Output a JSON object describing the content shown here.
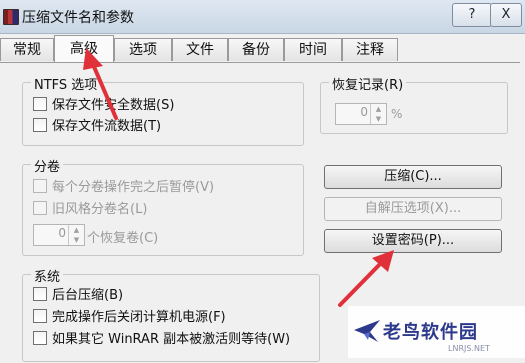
{
  "window": {
    "title": "压缩文件名和参数",
    "help_label": "?",
    "close_label": "X"
  },
  "tabs": [
    {
      "label": "常规"
    },
    {
      "label": "高级",
      "active": true
    },
    {
      "label": "选项"
    },
    {
      "label": "文件"
    },
    {
      "label": "备份"
    },
    {
      "label": "时间"
    },
    {
      "label": "注释"
    }
  ],
  "ntfs": {
    "title": "NTFS 选项",
    "items": [
      {
        "label": "保存文件安全数据(S)",
        "checked": false
      },
      {
        "label": "保存文件流数据(T)",
        "checked": false
      }
    ]
  },
  "recovery": {
    "title": "恢复记录(R)",
    "value": "0",
    "unit": "%"
  },
  "volume": {
    "title": "分卷",
    "items": [
      {
        "label": "每个分卷操作完之后暂停(V)",
        "checked": false,
        "enabled": false
      },
      {
        "label": "旧风格分卷名(L)",
        "checked": false,
        "enabled": false
      }
    ],
    "spinner_value": "0",
    "spinner_label": "个恢复卷(C)"
  },
  "buttons": {
    "compress": "压缩(C)...",
    "sfx": "自解压选项(X)...",
    "password": "设置密码(P)..."
  },
  "system": {
    "title": "系统",
    "items": [
      {
        "label": "后台压缩(B)",
        "checked": false
      },
      {
        "label": "完成操作后关闭计算机电源(F)",
        "checked": false
      },
      {
        "label": "如果其它 WinRAR 副本被激活则等待(W)",
        "checked": false
      }
    ]
  },
  "watermark": {
    "text": "老鸟软件园",
    "sub": "LNRJS.NET"
  },
  "colors": {
    "arrow": "#e0303a",
    "watermark": "#2d3a8c"
  }
}
